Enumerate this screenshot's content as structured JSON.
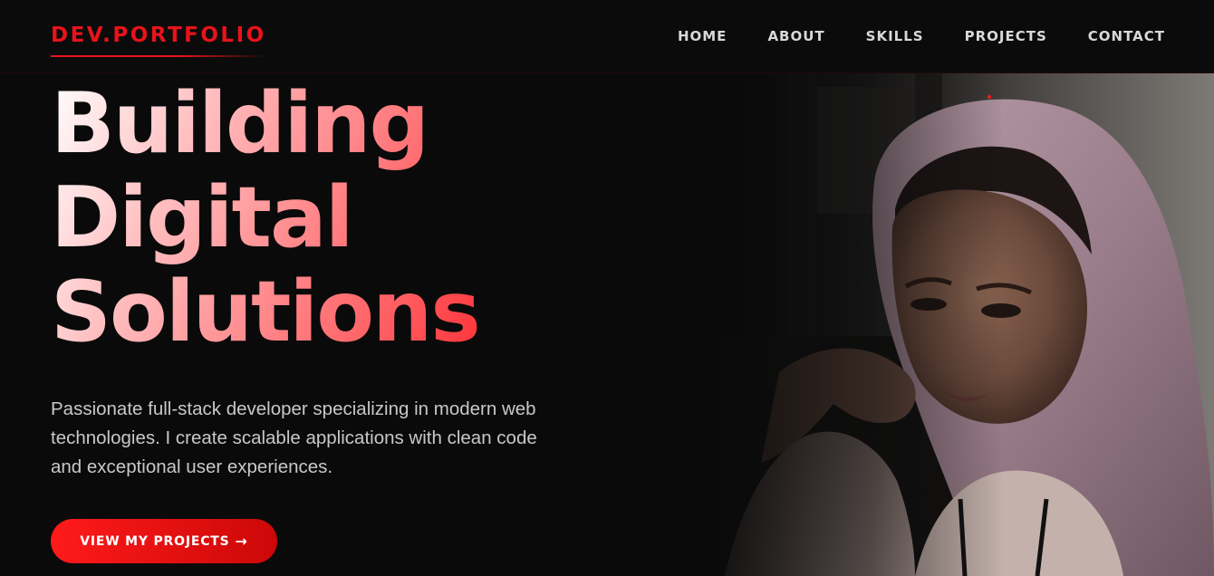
{
  "nav": {
    "logo": "DEV.PORTFOLIO",
    "links": [
      "HOME",
      "ABOUT",
      "SKILLS",
      "PROJECTS",
      "CONTACT"
    ]
  },
  "hero": {
    "title_lines": [
      "Building",
      "Digital",
      "Solutions"
    ],
    "description": "Passionate full-stack developer specializing in modern web technologies. I create scalable applications with clean code and exceptional user experiences.",
    "cta_label": "VIEW MY PROJECTS",
    "cta_arrow": "→",
    "photo_icon": "portrait-photo"
  },
  "colors": {
    "accent": "#e8131a",
    "background": "#0a0a0a",
    "nav_text": "#d9d9d9",
    "description_text": "#c8c8c8"
  }
}
